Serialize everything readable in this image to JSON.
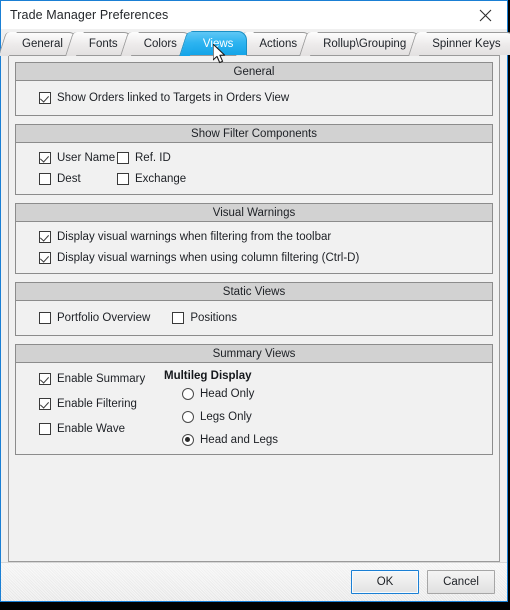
{
  "window": {
    "title": "Trade Manager Preferences",
    "close_icon": "close-icon",
    "accent_color": "#1a7fd4"
  },
  "tabs": {
    "active": "Views",
    "items": [
      {
        "label": "General"
      },
      {
        "label": "Fonts"
      },
      {
        "label": "Colors"
      },
      {
        "label": "Views"
      },
      {
        "label": "Actions"
      },
      {
        "label": "Rollup\\Grouping"
      },
      {
        "label": "Spinner Keys"
      }
    ]
  },
  "groups": {
    "general": {
      "title": "General",
      "checkboxes": [
        {
          "label": "Show Orders linked to Targets in Orders View",
          "checked": true
        }
      ]
    },
    "filter_components": {
      "title": "Show Filter Components",
      "checkboxes": [
        {
          "label": "User Name",
          "checked": true
        },
        {
          "label": "Ref. ID",
          "checked": false
        },
        {
          "label": "Dest",
          "checked": false
        },
        {
          "label": "Exchange",
          "checked": false
        }
      ]
    },
    "visual_warnings": {
      "title": "Visual Warnings",
      "checkboxes": [
        {
          "label": "Display visual warnings when filtering from the toolbar",
          "checked": true
        },
        {
          "label": "Display visual warnings when using column filtering (Ctrl-D)",
          "checked": true
        }
      ]
    },
    "static_views": {
      "title": "Static Views",
      "checkboxes": [
        {
          "label": "Portfolio Overview",
          "checked": false
        },
        {
          "label": "Positions",
          "checked": false
        }
      ]
    },
    "summary_views": {
      "title": "Summary Views",
      "checkboxes": [
        {
          "label": "Enable Summary",
          "checked": true
        },
        {
          "label": "Enable Filtering",
          "checked": true
        },
        {
          "label": "Enable Wave",
          "checked": false
        }
      ],
      "multileg": {
        "title": "Multileg Display",
        "selected": "Head and Legs",
        "options": [
          {
            "label": "Head Only",
            "selected": false
          },
          {
            "label": "Legs Only",
            "selected": false
          },
          {
            "label": "Head and Legs",
            "selected": true
          }
        ]
      }
    }
  },
  "footer": {
    "ok_label": "OK",
    "cancel_label": "Cancel"
  }
}
